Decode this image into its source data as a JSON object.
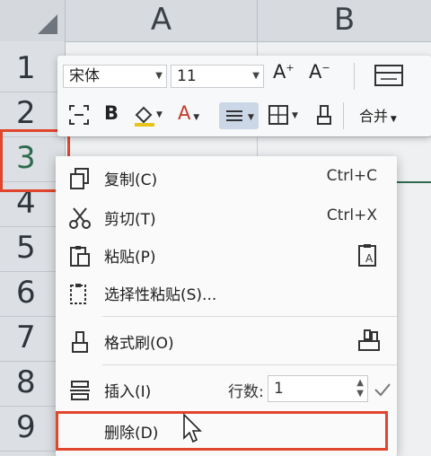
{
  "columns": [
    "A",
    "B"
  ],
  "rows": [
    "1",
    "2",
    "3",
    "4",
    "5",
    "6",
    "7",
    "8",
    "9"
  ],
  "toolbar": {
    "font_name": "宋体",
    "font_size": "11",
    "bold_label": "B",
    "font_color_label": "A",
    "merge_label": "合并",
    "grow_font_label": "A",
    "shrink_font_label": "A"
  },
  "context_menu": {
    "copy": {
      "label": "复制(C)",
      "shortcut": "Ctrl+C"
    },
    "cut": {
      "label": "剪切(T)",
      "shortcut": "Ctrl+X"
    },
    "paste": {
      "label": "粘贴(P)"
    },
    "paste_special": {
      "label": "选择性粘贴(S)..."
    },
    "format_painter": {
      "label": "格式刷(O)"
    },
    "insert": {
      "label": "插入(I)",
      "rows_label": "行数:",
      "rows_value": "1"
    },
    "delete": {
      "label": "删除(D)"
    }
  },
  "colors": {
    "highlight": "#e0452d",
    "selected_row": "#2e6b4c"
  }
}
